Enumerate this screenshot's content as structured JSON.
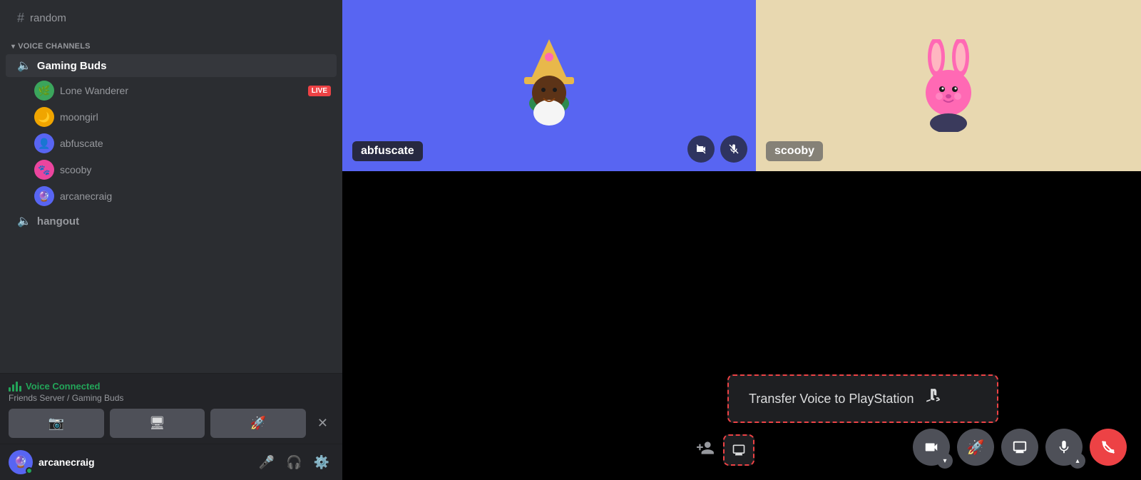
{
  "sidebar": {
    "channels": [
      {
        "name": "random",
        "type": "text"
      }
    ],
    "voice_section_label": "VOICE CHANNELS",
    "voice_channels": [
      {
        "name": "Gaming Buds",
        "active": true,
        "members": [
          {
            "name": "Lone Wanderer",
            "live": true,
            "color": "#3ba55c"
          },
          {
            "name": "moongirl",
            "live": false,
            "color": "#f0a500"
          },
          {
            "name": "abfuscate",
            "live": false,
            "color": "#5865f2"
          },
          {
            "name": "scooby",
            "live": false,
            "color": "#eb459e"
          },
          {
            "name": "arcanecraig",
            "live": false,
            "color": "#5865f2"
          }
        ]
      },
      {
        "name": "hangout",
        "active": false,
        "members": []
      }
    ],
    "voice_connected": {
      "label": "Voice Connected",
      "server": "Friends Server / Gaming Buds"
    },
    "actions": {
      "camera": "📷",
      "screen_share": "🖥",
      "boost": "🚀"
    },
    "user": {
      "name": "arcanecraig",
      "status": "online"
    }
  },
  "main": {
    "participants": [
      {
        "name": "abfuscate",
        "bg": "#5865f2"
      },
      {
        "name": "scooby",
        "bg": "#e8d8b0"
      }
    ],
    "transfer_popup": {
      "label": "Transfer Voice to PlayStation"
    },
    "toolbar": {
      "camera": "📷",
      "boost": "🚀",
      "screen_share": "🖥",
      "mic": "🎤",
      "disconnect_label": "✕"
    }
  }
}
